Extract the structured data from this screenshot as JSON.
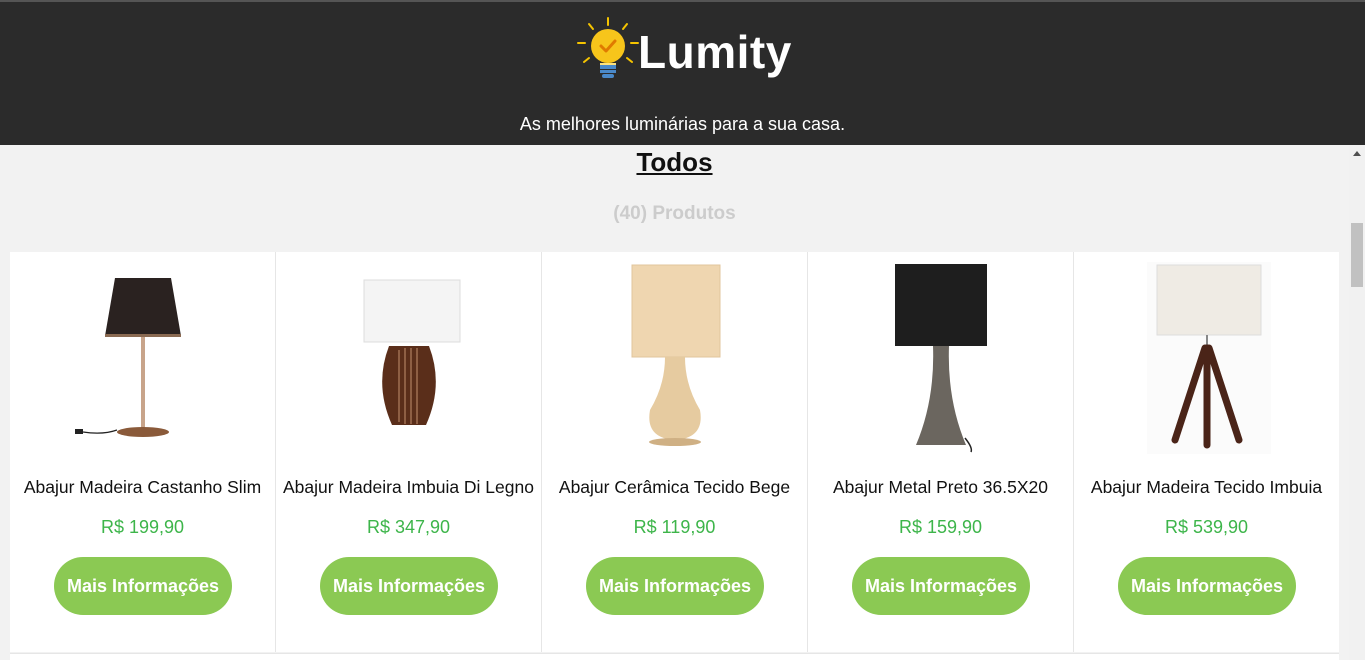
{
  "header": {
    "brand": "Lumity",
    "tagline": "As melhores luminárias para a sua casa."
  },
  "catalog": {
    "title": "Todos",
    "count_label": "(40) Produtos"
  },
  "products": [
    {
      "name": "Abajur Madeira Castanho Slim",
      "price": "R$ 199,90",
      "button": "Mais Informações"
    },
    {
      "name": "Abajur Madeira Imbuia Di Legno",
      "price": "R$ 347,90",
      "button": "Mais Informações"
    },
    {
      "name": "Abajur Cerâmica Tecido Bege",
      "price": "R$ 119,90",
      "button": "Mais Informações"
    },
    {
      "name": "Abajur Metal Preto 36.5X20",
      "price": "R$ 159,90",
      "button": "Mais Informações"
    },
    {
      "name": "Abajur Madeira Tecido Imbuia",
      "price": "R$ 539,90",
      "button": "Mais Informações"
    }
  ],
  "colors": {
    "header_bg": "#2b2b2b",
    "price": "#3db54a",
    "button": "#8bc953",
    "count": "#cccccc"
  }
}
